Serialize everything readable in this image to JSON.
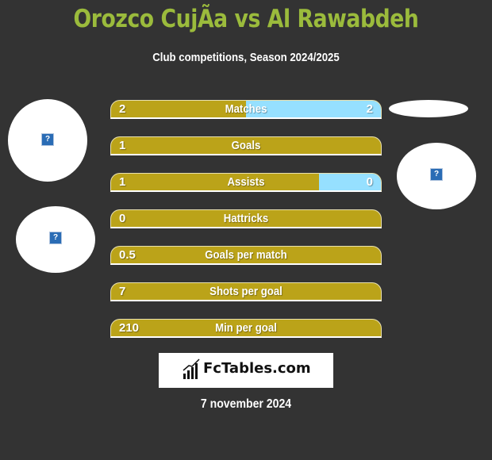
{
  "header": {
    "title": "Orozco CujÃa vs Al Rawabdeh",
    "subtitle": "Club competitions, Season 2024/2025"
  },
  "colors": {
    "left": "#bba319",
    "right": "#96e0ff",
    "title": "#9bbb3c",
    "background": "#333333"
  },
  "stats": [
    {
      "label": "Matches",
      "left": "2",
      "right": "2",
      "right_share": 0.5
    },
    {
      "label": "Goals",
      "left": "1",
      "right": "",
      "right_share": 0
    },
    {
      "label": "Assists",
      "left": "1",
      "right": "0",
      "right_share": 0.23
    },
    {
      "label": "Hattricks",
      "left": "0",
      "right": "",
      "right_share": 0
    },
    {
      "label": "Goals per match",
      "left": "0.5",
      "right": "",
      "right_share": 0
    },
    {
      "label": "Shots per goal",
      "left": "7",
      "right": "",
      "right_share": 0
    },
    {
      "label": "Min per goal",
      "left": "210",
      "right": "",
      "right_share": 0
    }
  ],
  "images": {
    "placeholder_glyph": "?"
  },
  "footer": {
    "logo_text": "FcTables.com",
    "date": "7 november 2024"
  }
}
